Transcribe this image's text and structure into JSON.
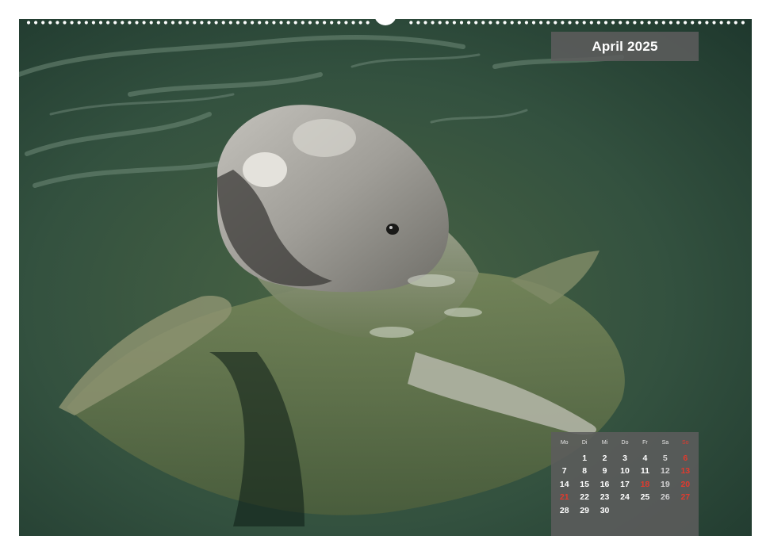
{
  "calendar": {
    "month_title": "April 2025",
    "weekday_headers": [
      "Mo",
      "Di",
      "Mi",
      "Do",
      "Fr",
      "Sa",
      "So"
    ],
    "leading_blank_days": 1,
    "days": [
      "1",
      "2",
      "3",
      "4",
      "5",
      "6",
      "7",
      "8",
      "9",
      "10",
      "11",
      "12",
      "13",
      "14",
      "15",
      "16",
      "17",
      "18",
      "19",
      "20",
      "21",
      "22",
      "23",
      "24",
      "25",
      "26",
      "27",
      "28",
      "29",
      "30"
    ],
    "red_days": [
      "6",
      "13",
      "18",
      "20",
      "21",
      "27"
    ],
    "colors": {
      "panel": "#5c5c5c",
      "text": "#ffffff",
      "sunday_holiday": "#e03a2e",
      "saturday": "#d2d2d2"
    }
  },
  "photo": {
    "subject": "dolphin-in-green-water",
    "colors": {
      "water_dark": "#1f3a30",
      "water_mid": "#3d5a3e",
      "dolphin": "#9a9a96"
    }
  }
}
